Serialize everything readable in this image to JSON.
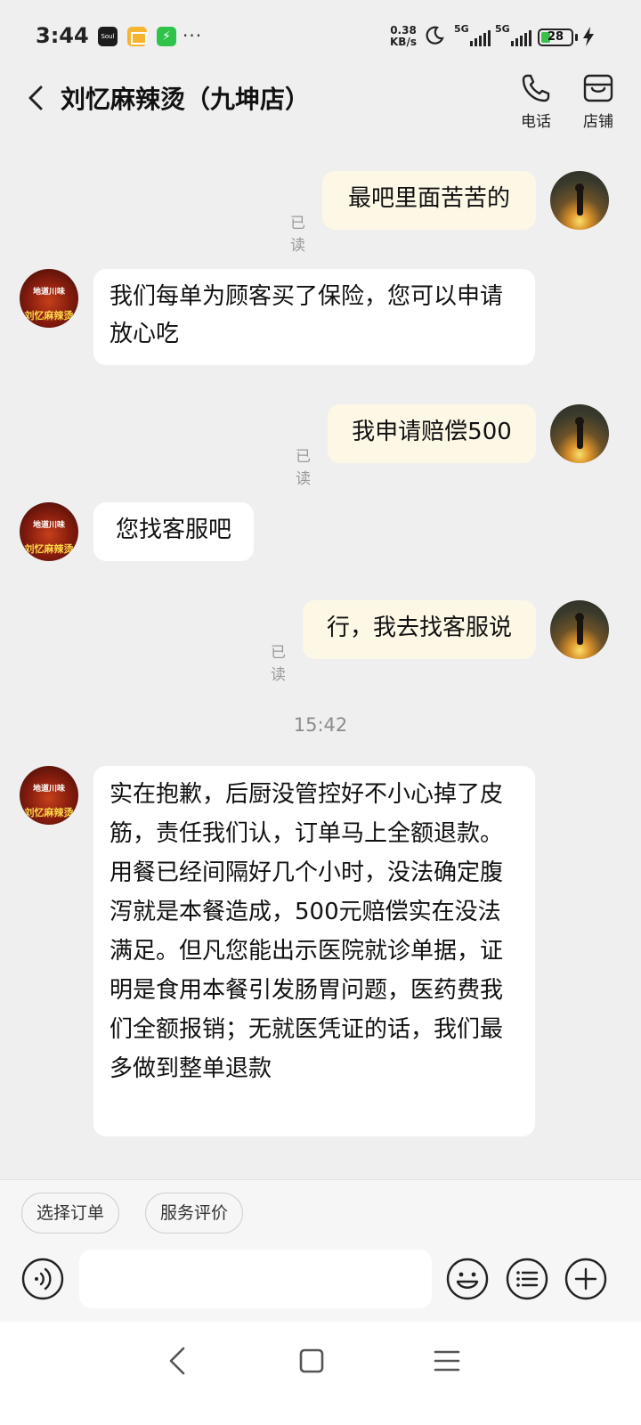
{
  "status_bar": {
    "time": "3:44",
    "app_soul": "Soul",
    "more": "···",
    "speed_value": "0.38",
    "speed_unit": "KB/s",
    "signal_1": "5G",
    "signal_2": "5G",
    "battery": "28"
  },
  "header": {
    "title": "刘忆麻辣烫（九坤店）",
    "phone_label": "电话",
    "shop_label": "店铺"
  },
  "read_label": "已读",
  "shop_avatar": {
    "line1": "地道川味",
    "line2": "刘忆麻辣烫"
  },
  "messages": [
    {
      "side": "out",
      "text": "最吧里面苦苦的"
    },
    {
      "side": "in",
      "text": "我们每单为顾客买了保险，您可以申请放心吃"
    },
    {
      "side": "out",
      "text": "我申请赔偿500"
    },
    {
      "side": "in",
      "text": "您找客服吧"
    },
    {
      "side": "out",
      "text": "行，我去找客服说"
    },
    {
      "side": "in",
      "text": "实在抱歉，后厨没管控好不小心掉了皮筋，责任我们认，订单马上全额退款。\n用餐已经间隔好几个小时，没法确定腹泻就是本餐造成，500元赔偿实在没法满足。但凡您能出示医院就诊单据，证明是食用本餐引发肠胃问题，医药费我们全额报销；无就医凭证的话，我们最多做到整单退款"
    }
  ],
  "timestamp": "15:42",
  "quick_actions": {
    "select_order": "选择订单",
    "service_review": "服务评价"
  },
  "input": {
    "placeholder": ""
  }
}
